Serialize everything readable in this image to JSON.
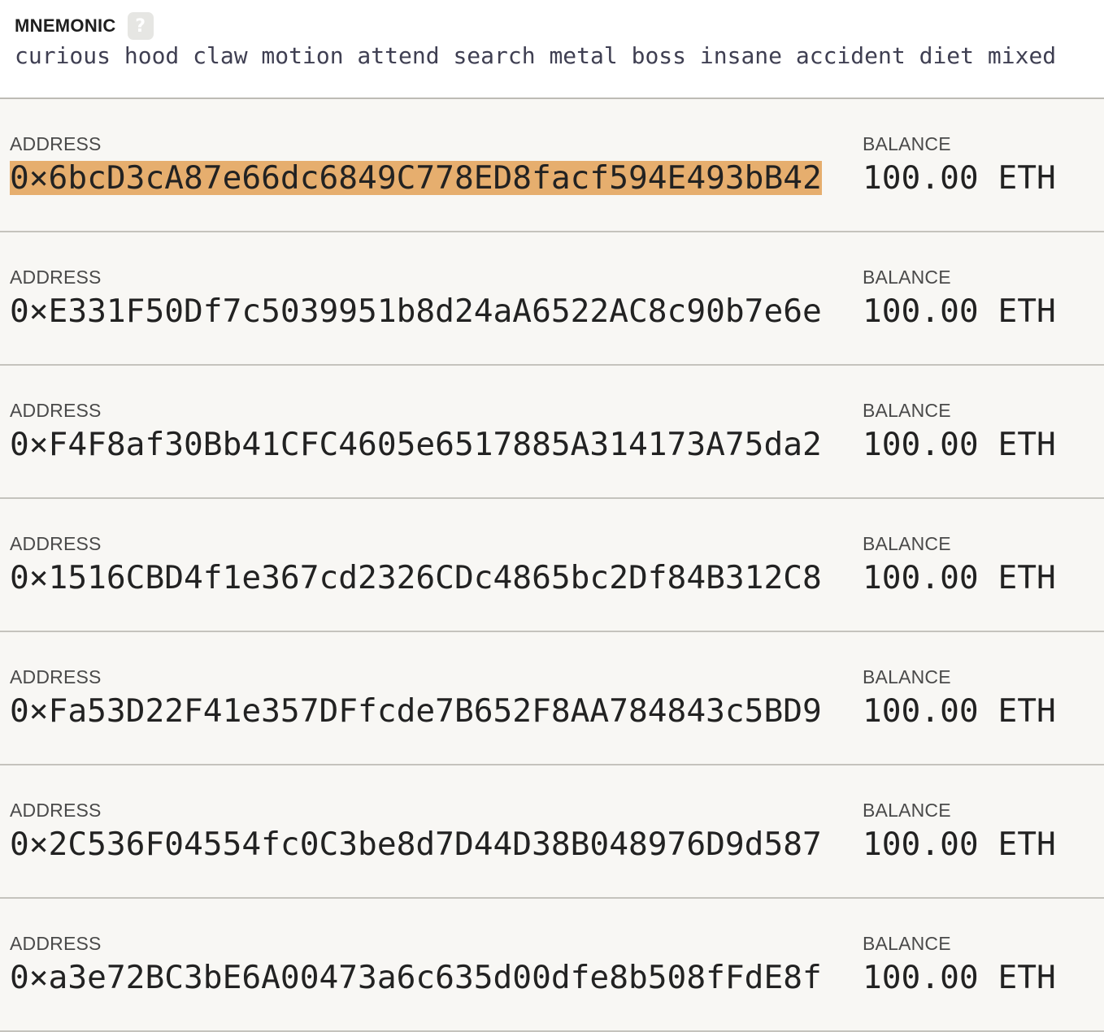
{
  "mnemonic": {
    "label": "MNEMONIC",
    "help_icon": "question-mark-icon",
    "help_glyph": "?",
    "words": "curious hood claw motion attend search metal boss insane accident diet mixed"
  },
  "columns": {
    "address_label": "ADDRESS",
    "balance_label": "BALANCE"
  },
  "colors": {
    "selection_highlight": "#e6ae6e",
    "row_background": "#f8f7f4"
  },
  "accounts": [
    {
      "address": "0×6bcD3cA87e66dc6849C778ED8facf594E493bB42",
      "balance": "100.00 ETH",
      "selected": true
    },
    {
      "address": "0×E331F50Df7c5039951b8d24aA6522AC8c90b7e6e",
      "balance": "100.00 ETH",
      "selected": false
    },
    {
      "address": "0×F4F8af30Bb41CFC4605e6517885A314173A75da2",
      "balance": "100.00 ETH",
      "selected": false
    },
    {
      "address": "0×1516CBD4f1e367cd2326CDc4865bc2Df84B312C8",
      "balance": "100.00 ETH",
      "selected": false
    },
    {
      "address": "0×Fa53D22F41e357DFfcde7B652F8AA784843c5BD9",
      "balance": "100.00 ETH",
      "selected": false
    },
    {
      "address": "0×2C536F04554fc0C3be8d7D44D38B048976D9d587",
      "balance": "100.00 ETH",
      "selected": false
    },
    {
      "address": "0×a3e72BC3bE6A00473a6c635d00dfe8b508fFdE8f",
      "balance": "100.00 ETH",
      "selected": false
    }
  ]
}
